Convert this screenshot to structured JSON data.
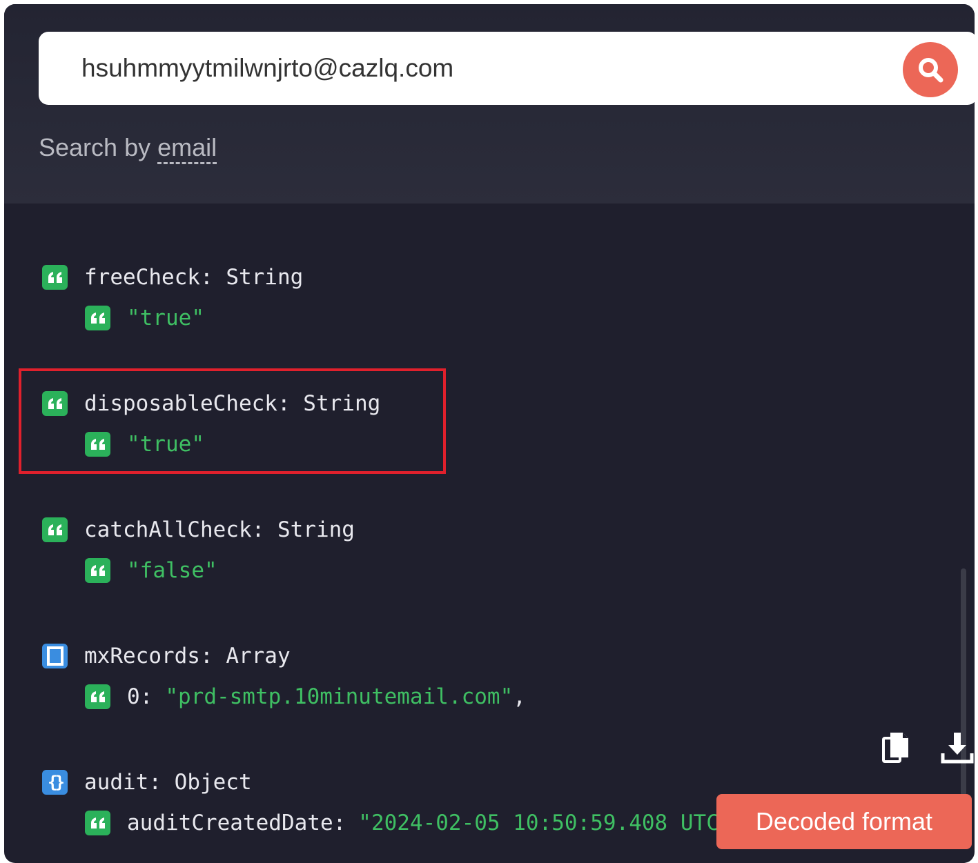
{
  "search": {
    "value": "hsuhmmyytmilwnjrto@cazlq.com",
    "hint_prefix": "Search by",
    "hint_underlined": "email"
  },
  "tree": {
    "nodes": [
      {
        "key": "freeCheck",
        "type": "String",
        "value": "\"true\""
      },
      {
        "key": "disposableCheck",
        "type": "String",
        "value": "\"true\""
      },
      {
        "key": "catchAllCheck",
        "type": "String",
        "value": "\"false\""
      },
      {
        "key": "mxRecords",
        "type": "Array",
        "index": "0:",
        "value": "\"prd-smtp.10minutemail.com\"",
        "suffix": ","
      },
      {
        "key": "audit",
        "type": "Object",
        "child_key": "auditCreatedDate:",
        "value": "\"2024-02-05 10:50:59.408 UTC\"",
        "suffix": ","
      }
    ]
  },
  "actions": {
    "decoded_label": "Decoded format",
    "copy_icon": "copy-icon",
    "download_icon": "download-icon"
  },
  "colors": {
    "accent": "#ec6757",
    "string_icon": "#2bb15a",
    "array_icon": "#3a8de0",
    "highlight_border": "#e0202c",
    "panel_bg": "#1f1f2d"
  }
}
